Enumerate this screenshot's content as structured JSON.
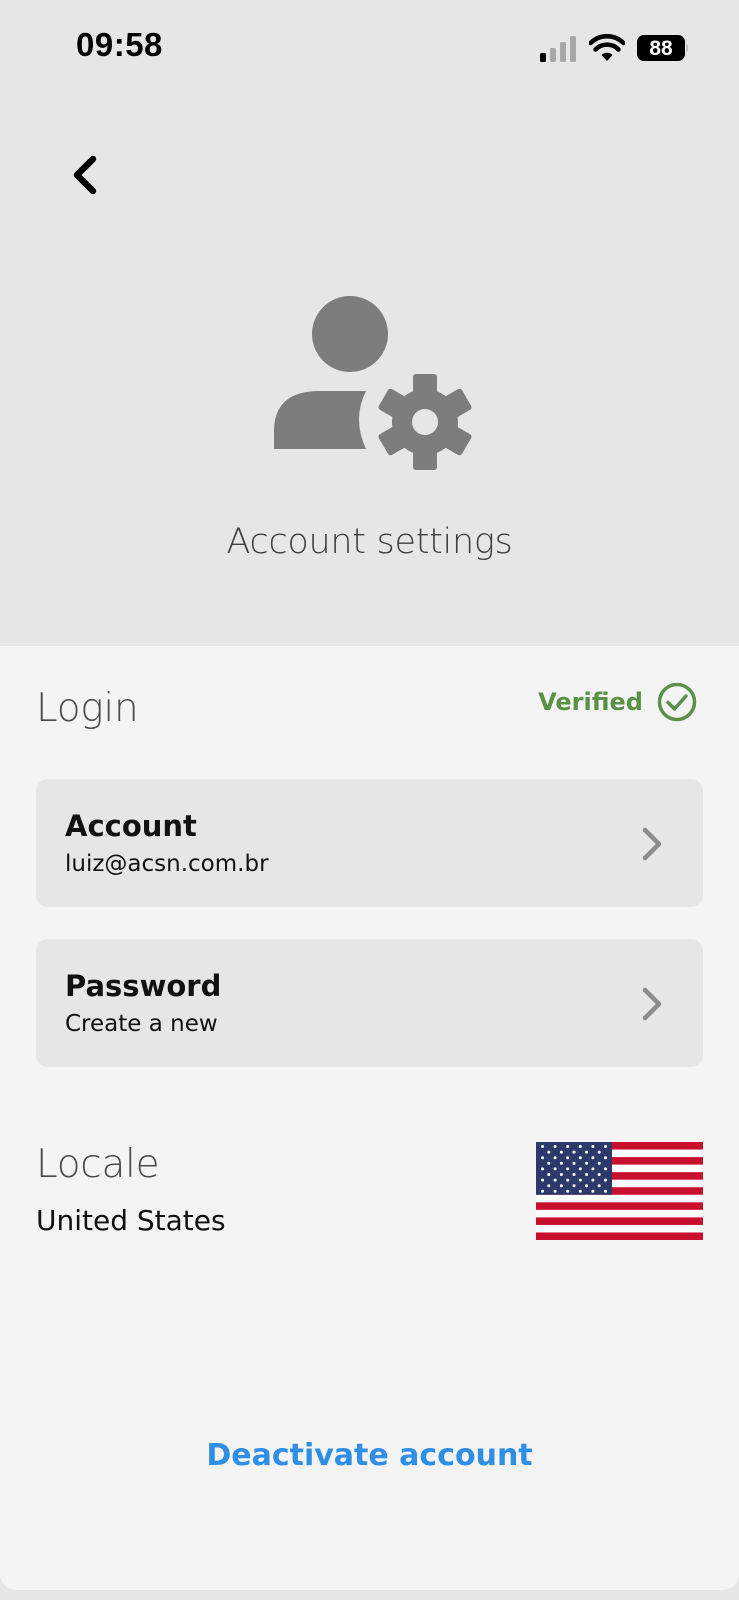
{
  "status_bar": {
    "time": "09:58",
    "battery_level": "88",
    "icons": [
      "cellular-signal-icon",
      "wifi-icon",
      "battery-icon"
    ]
  },
  "header": {
    "back_icon": "chevron-left-icon",
    "hero_icon": "user-settings-icon",
    "title": "Account settings"
  },
  "login": {
    "heading": "Login",
    "status_label": "Verified",
    "status_icon": "check-circle-icon",
    "status_color": "#5a9147"
  },
  "cards": {
    "account": {
      "title": "Account",
      "subtitle": "luiz@acsn.com.br",
      "icon": "chevron-right-icon"
    },
    "password": {
      "title": "Password",
      "subtitle": "Create a new",
      "icon": "chevron-right-icon"
    }
  },
  "locale": {
    "heading": "Locale",
    "value": "United States",
    "flag_icon": "us-flag-icon"
  },
  "actions": {
    "deactivate_label": "Deactivate account",
    "accent_color": "#2f8ee6"
  }
}
